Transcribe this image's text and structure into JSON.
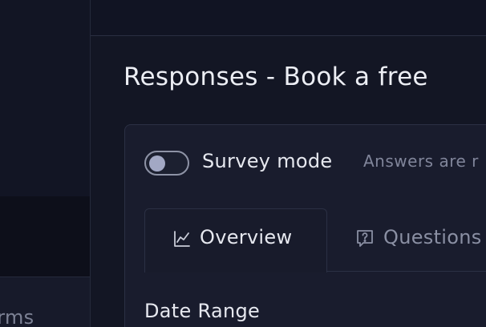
{
  "sidebar": {
    "items": [
      {
        "label": "Forms"
      }
    ]
  },
  "page": {
    "title": "Responses - Book a free"
  },
  "survey": {
    "toggle_label": "Survey mode",
    "toggle_on": false,
    "hint": "Answers are r"
  },
  "tabs": [
    {
      "label": "Overview",
      "icon": "line-chart-icon",
      "active": true
    },
    {
      "label": "Questions",
      "icon": "question-message-icon",
      "active": false
    }
  ],
  "filters": {
    "date_range_label": "Date Range"
  },
  "colors": {
    "background": "#131624",
    "card": "#191c2d",
    "text_primary": "#e6e8ef",
    "text_muted": "#80859a"
  }
}
